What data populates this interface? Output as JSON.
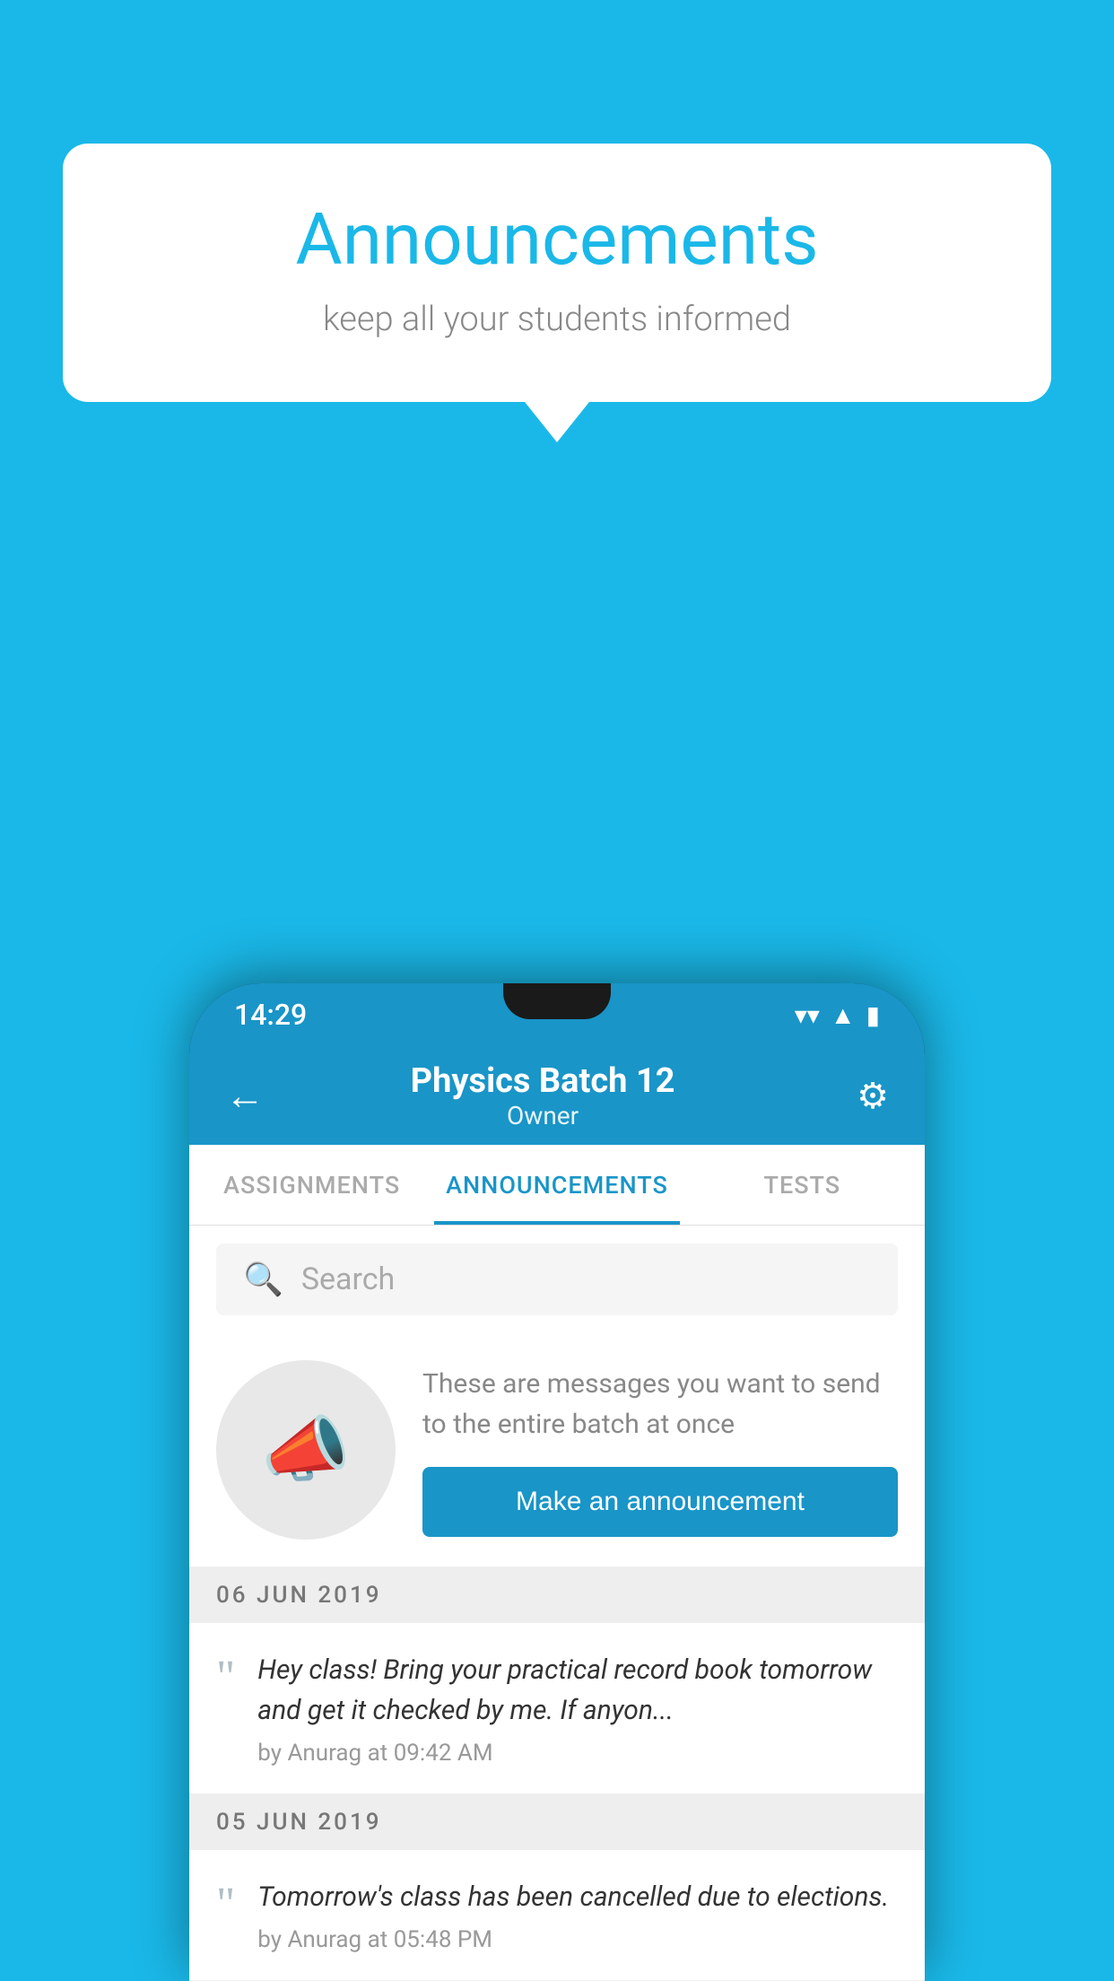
{
  "background_color": "#1ab8e8",
  "speech_bubble": {
    "title": "Announcements",
    "subtitle": "keep all your students informed"
  },
  "phone": {
    "status_bar": {
      "time": "14:29",
      "icons": [
        "wifi",
        "signal",
        "battery"
      ]
    },
    "app_bar": {
      "back_label": "←",
      "title": "Physics Batch 12",
      "subtitle": "Owner",
      "settings_label": "⚙"
    },
    "tabs": [
      {
        "label": "ASSIGNMENTS",
        "active": false
      },
      {
        "label": "ANNOUNCEMENTS",
        "active": true
      },
      {
        "label": "TESTS",
        "active": false
      }
    ],
    "search": {
      "placeholder": "Search"
    },
    "promo": {
      "description_text": "These are messages you want to send to the entire batch at once",
      "button_label": "Make an announcement"
    },
    "announcements": [
      {
        "date": "06  JUN  2019",
        "items": [
          {
            "text": "Hey class! Bring your practical record book tomorrow and get it checked by me. If anyon...",
            "meta": "by Anurag at 09:42 AM"
          }
        ]
      },
      {
        "date": "05  JUN  2019",
        "items": [
          {
            "text": "Tomorrow's class has been cancelled due to elections.",
            "meta": "by Anurag at 05:48 PM"
          }
        ]
      }
    ]
  }
}
